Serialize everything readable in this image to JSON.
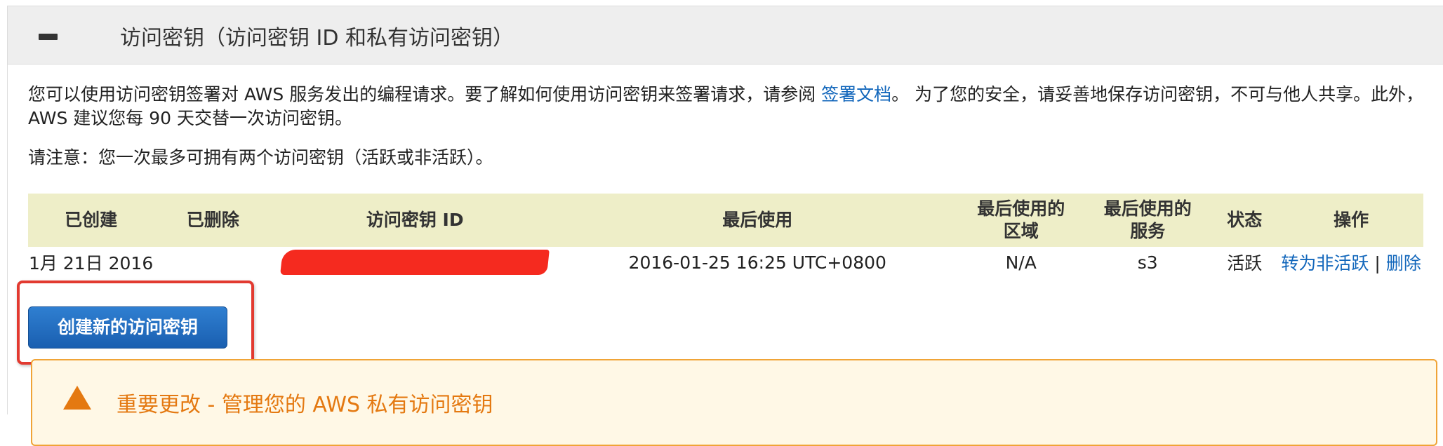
{
  "panel": {
    "title": "访问密钥（访问密钥 ID 和私有访问密钥）"
  },
  "description": {
    "part1": "您可以使用访问密钥签署对 AWS 服务发出的编程请求。要了解如何使用访问密钥来签署请求，请参阅 ",
    "link": "签署文档",
    "part2": "。 为了您的安全，请妥善地保存访问密钥，不可与他人共享。此外，AWS 建议您每 90 天交替一次访问密钥。"
  },
  "note": "请注意：您一次最多可拥有两个访问密钥（活跃或非活跃）。",
  "table": {
    "headers": [
      "已创建",
      "已删除",
      "访问密钥 ID",
      "最后使用",
      "最后使用的区域",
      "最后使用的服务",
      "状态",
      "操作"
    ],
    "header_lines": {
      "region": [
        "最后使用的",
        "区域"
      ],
      "service": [
        "最后使用的",
        "服务"
      ]
    },
    "rows": [
      {
        "created": "1月 21日 2016",
        "deleted": "",
        "key_id": "",
        "last_used": "2016-01-25 16:25 UTC+0800",
        "region": "N/A",
        "service": "s3",
        "status": "活跃",
        "action_deactivate": "转为非活跃",
        "action_separator": "|",
        "action_delete": "删除"
      }
    ]
  },
  "create_button": "创建新的访问密钥",
  "warning": {
    "title": "重要更改 - 管理您的 AWS 私有访问密钥"
  },
  "colors": {
    "link": "#1166bb",
    "header_bg": "#eeeec8",
    "button": "#1a5fb0",
    "highlight": "#e23a30",
    "warning": "#e47911"
  }
}
